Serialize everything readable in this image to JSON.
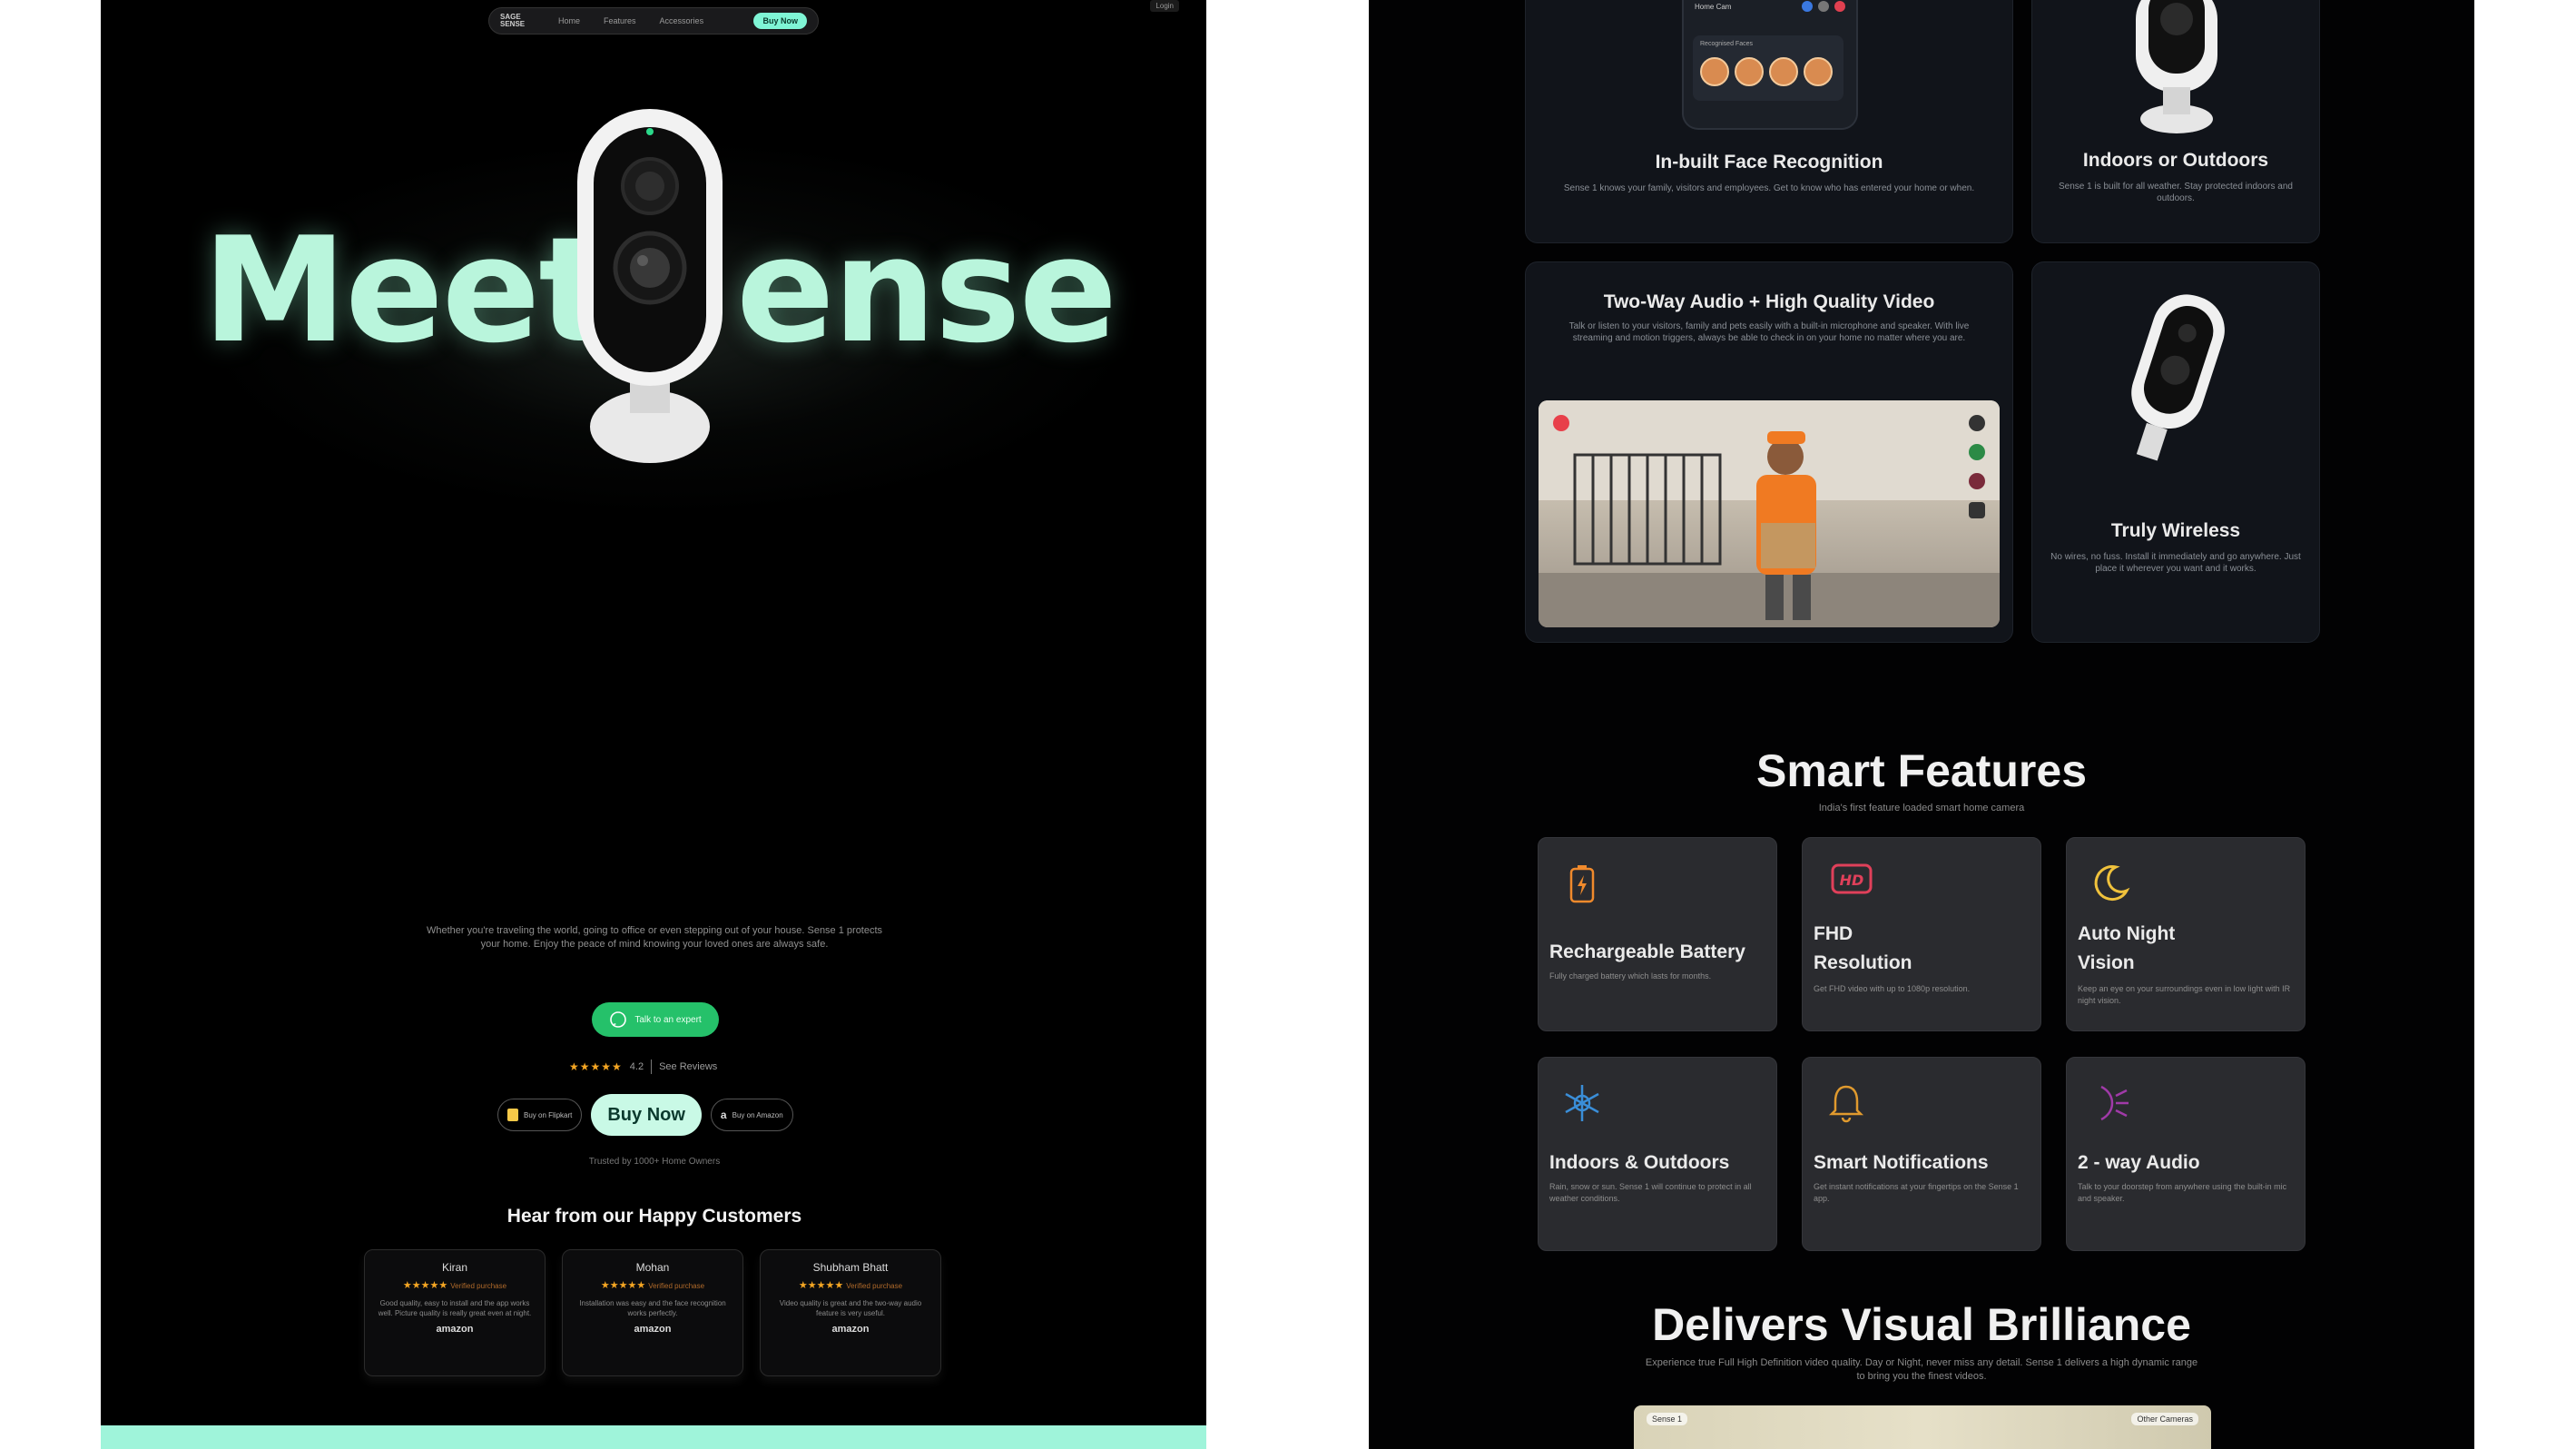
{
  "left": {
    "nav": {
      "logo": "SAGE SENSE",
      "links": [
        "Home",
        "Features",
        "Accessories"
      ],
      "cta": "Buy Now"
    },
    "corner_button": "Login",
    "hero": {
      "part1": "Meet",
      "part2": "ense"
    },
    "tagline": "Whether you're traveling the world, going to office or even stepping out of your house. Sense 1 protects your home. Enjoy the peace of mind knowing your loved ones are always safe.",
    "whatsapp_label": "Talk to an expert",
    "rating": {
      "stars": "★★★★★",
      "score": "4.2",
      "reviews_label": "See Reviews"
    },
    "store_buttons": {
      "flipkart": "Buy on Flipkart",
      "buy_now": "Buy Now",
      "amazon": "Buy on Amazon"
    },
    "trusted": "Trusted by 1000+ Home Owners",
    "reviews_title": "Hear from our Happy Customers",
    "reviews": [
      {
        "name": "Kiran",
        "stars": "★★★★★",
        "badge": "Verified purchase",
        "text": "Good quality, easy to install and the app works well. Picture quality is really great even at night.",
        "store": "amazon"
      },
      {
        "name": "Mohan",
        "stars": "★★★★★",
        "badge": "Verified purchase",
        "text": "Installation was easy and the face recognition works perfectly.",
        "store": "amazon"
      },
      {
        "name": "Shubham Bhatt",
        "stars": "★★★★★",
        "badge": "Verified purchase",
        "text": "Video quality is great and the two-way audio feature is very useful.",
        "store": "amazon"
      }
    ]
  },
  "right": {
    "cards": {
      "face_title": "In-built Face Recognition",
      "face_desc": "Sense 1 knows your family, visitors and employees. Get to know who has entered your home or when.",
      "phone_header": "Home Cam",
      "phone_section": "Recognised Faces",
      "outdoor_title": "Indoors or Outdoors",
      "outdoor_desc": "Sense 1 is built for all weather. Stay protected indoors and outdoors.",
      "audio_title": "Two-Way Audio + High Quality Video",
      "audio_desc": "Talk or listen to your visitors, family and pets easily with a built-in microphone and speaker. With live streaming and motion triggers, always be able to check in on your home no matter where you are.",
      "wireless_title": "Truly Wireless",
      "wireless_desc": "No wires, no fuss. Install it immediately and go anywhere. Just place it wherever you want and it works."
    },
    "smart": {
      "title": "Smart Features",
      "subtitle": "India's first feature loaded smart home camera",
      "items": [
        {
          "name": "Rechargeable Battery",
          "desc": "Fully charged battery which lasts for months.",
          "icon": "battery-icon",
          "color": "#f08a2c"
        },
        {
          "name": "FHD Resolution",
          "desc": "Get FHD video with up to 1080p resolution.",
          "icon": "hd-icon",
          "color": "#e0405a"
        },
        {
          "name": "Auto Night Vision",
          "desc": "Keep an eye on your surroundings even in low light with IR night vision.",
          "icon": "moon-icon",
          "color": "#f0c23c"
        },
        {
          "name": "Indoors & Outdoors",
          "desc": "Rain, snow or sun. Sense 1 will continue to protect in all weather conditions.",
          "icon": "weather-icon",
          "color": "#3a8ed8"
        },
        {
          "name": "Smart Notifications",
          "desc": "Get instant notifications at your fingertips on the Sense 1 app.",
          "icon": "bell-icon",
          "color": "#e09a2e"
        },
        {
          "name": "2 - way Audio",
          "desc": "Talk to your doorstep from anywhere using the built-in mic and speaker.",
          "icon": "audio-icon",
          "color": "#a03aa8"
        }
      ]
    },
    "visual": {
      "title": "Delivers Visual Brilliance",
      "subtitle": "Experience true Full High Definition video quality. Day or Night, never miss any detail. Sense 1 delivers a high dynamic range to bring you the finest videos.",
      "tag_left": "Sense 1",
      "tag_right": "Other Cameras"
    }
  }
}
